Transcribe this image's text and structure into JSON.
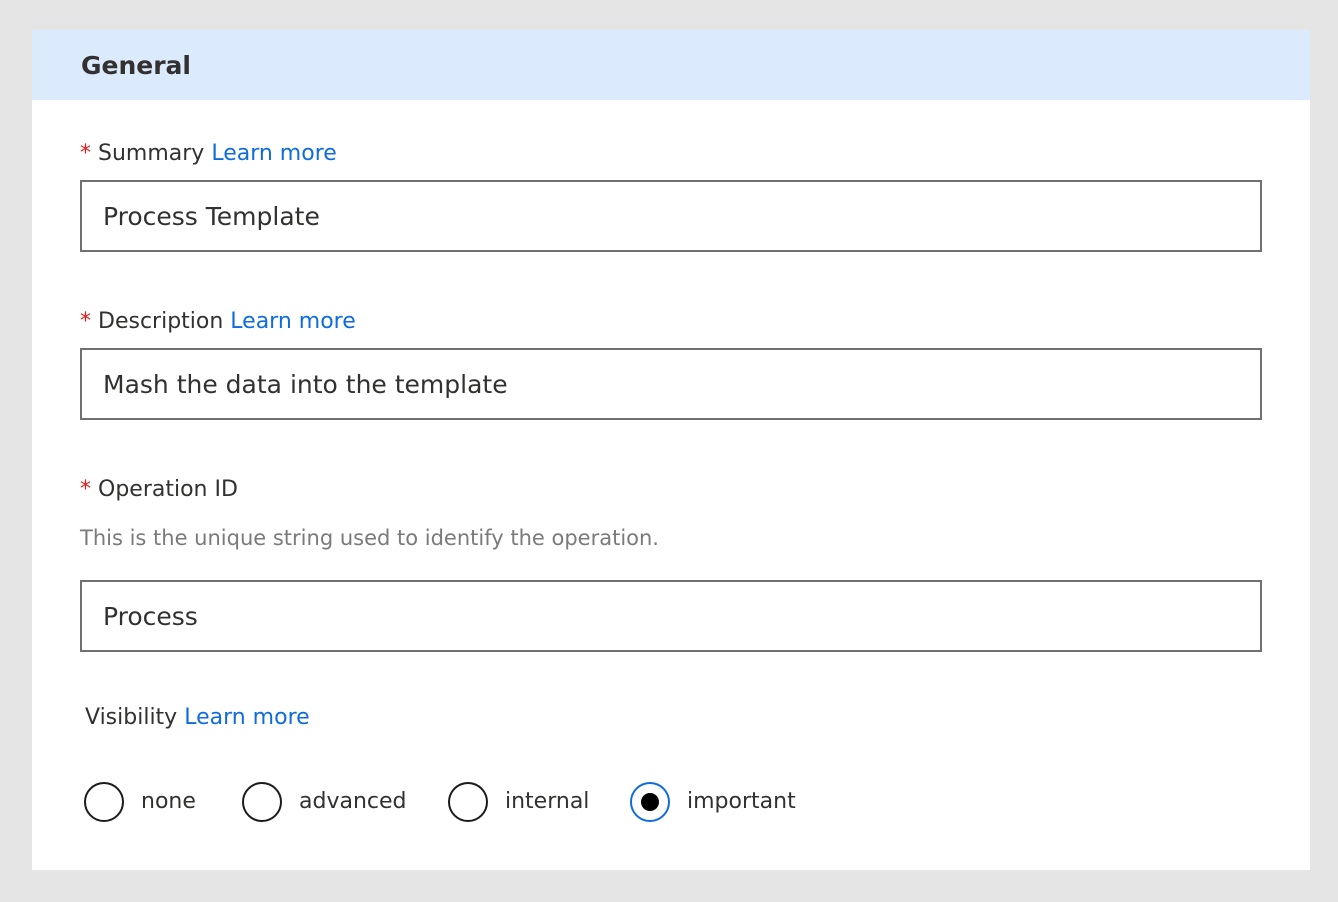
{
  "panel": {
    "title": "General"
  },
  "summary": {
    "required_mark": "*",
    "label": "Summary",
    "link": "Learn more",
    "value": "Process Template"
  },
  "description": {
    "required_mark": "*",
    "label": "Description",
    "link": "Learn more",
    "value": "Mash the data into the template"
  },
  "operation_id": {
    "required_mark": "*",
    "label": "Operation ID",
    "helper": "This is the unique string used to identify the operation.",
    "value": "Process"
  },
  "visibility": {
    "label": "Visibility",
    "link": "Learn more",
    "selected": "important",
    "options": [
      {
        "label": "none",
        "checked": false
      },
      {
        "label": "advanced",
        "checked": false
      },
      {
        "label": "internal",
        "checked": false
      },
      {
        "label": "important",
        "checked": true
      }
    ]
  },
  "colors": {
    "header_bg": "#dbeafc",
    "link": "#0f6cdd",
    "required": "#e8191a",
    "radio_selected_ring": "#0f6cdd"
  }
}
